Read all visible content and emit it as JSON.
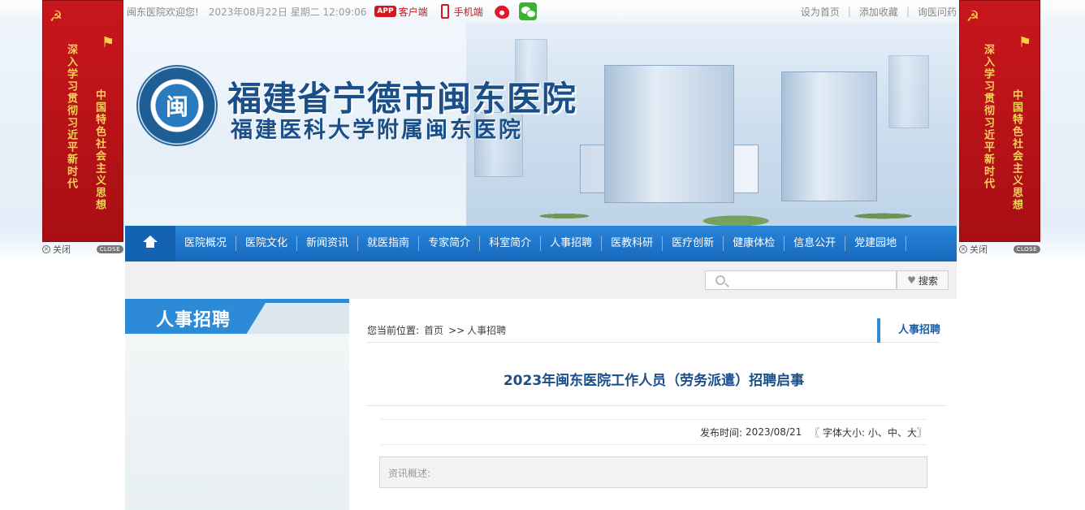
{
  "topbar": {
    "welcome": "闽东医院欢迎您!",
    "datetime": "2023年08月22日  星期二 12:09:06",
    "app_badge": "APP",
    "client_label": "客户端",
    "mobile_label": "手机端",
    "set_home": "设为首页",
    "add_fav": "添加收藏",
    "consult": "询医问药"
  },
  "side_banner": {
    "line1": "深入学习贯彻习近平新时代",
    "line2": "中国特色社会主义思想",
    "close_label": "关闭",
    "close_tag": "CLOSE"
  },
  "header": {
    "logo_char": "闽",
    "title_main": "福建省宁德市闽东医院",
    "title_sub": "福建医科大学附属闽东医院"
  },
  "nav": {
    "items": [
      "医院概况",
      "医院文化",
      "新闻资讯",
      "就医指南",
      "专家简介",
      "科室简介",
      "人事招聘",
      "医教科研",
      "医疗创新",
      "健康体检",
      "信息公开",
      "党建园地"
    ]
  },
  "search": {
    "placeholder": "",
    "button_label": "搜索"
  },
  "sidebar": {
    "title": "人事招聘"
  },
  "breadcrumb": {
    "label": "您当前位置:",
    "home": "首页",
    "sep": ">>",
    "current": "人事招聘",
    "section_tag": "人事招聘"
  },
  "article": {
    "title": "2023年闽东医院工作人员（劳务派遣）招聘启事",
    "publish_label": "发布时间:",
    "publish_date": "2023/08/21",
    "font_size_open": "〖 字体大小:",
    "font_small": "小",
    "font_mid": "中",
    "font_large": "大",
    "font_size_close": "〗",
    "summary_label": "资讯概述:"
  }
}
